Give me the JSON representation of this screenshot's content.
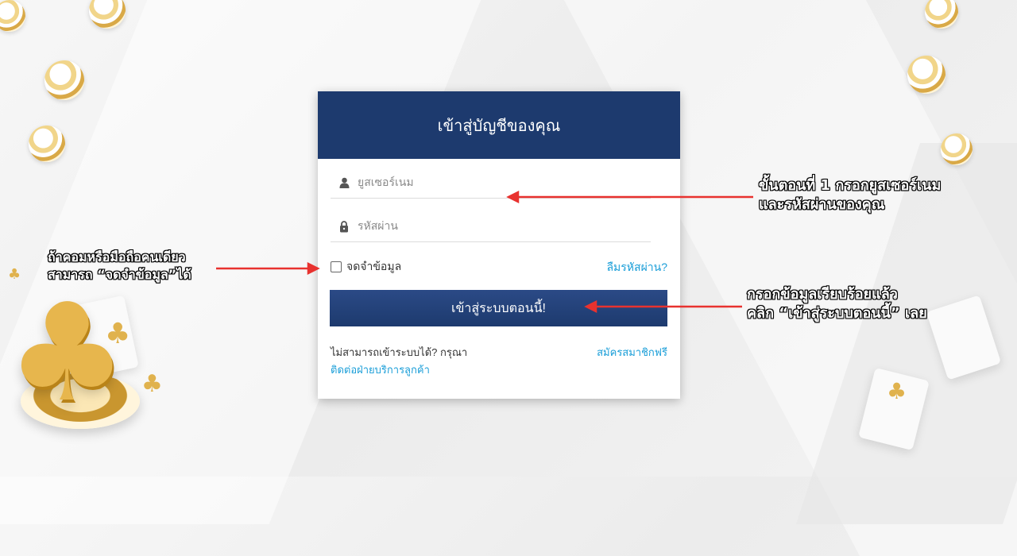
{
  "login": {
    "title": "เข้าสู่บัญชีของคุณ",
    "username_placeholder": "ยูสเซอร์เนม",
    "password_placeholder": "รหัสผ่าน",
    "remember_label": "จดจำข้อมูล",
    "forgot_label": "ลืมรหัสผ่าน?",
    "login_button": "เข้าสู่ระบบตอนนี้!",
    "cant_login_text": "ไม่สามารถเข้าระบบได้? กรุณา",
    "contact_link": "ติดต่อฝ่ายบริการลูกค้า",
    "register_link": "สมัครสมาชิกฟรี"
  },
  "annotations": {
    "remember_note": [
      "ถ้าคอมหรือมือถือคนเดียว",
      "สามารถ “จดจำข้อมูล”ได้"
    ],
    "step1_note": [
      "ขั้นตอนที่ 1 กรอกยูสเซอร์เนม",
      "และรหัสผ่านของคุณ"
    ],
    "submit_note": [
      "กรอกข้อมูลเรียบร้อยแล้ว",
      "คลิก “เข้าสู่ระบบตอนนี้” เลย"
    ]
  },
  "icons": {
    "username": "user-icon",
    "password": "lock-icon",
    "decor": [
      "poker-chip-icon",
      "club-icon",
      "playing-card-icon"
    ]
  },
  "colors": {
    "header_bg": "#1d3a6e",
    "link": "#1a9ed8",
    "arrow": "#e8322f",
    "gold": "#e0b24d"
  }
}
